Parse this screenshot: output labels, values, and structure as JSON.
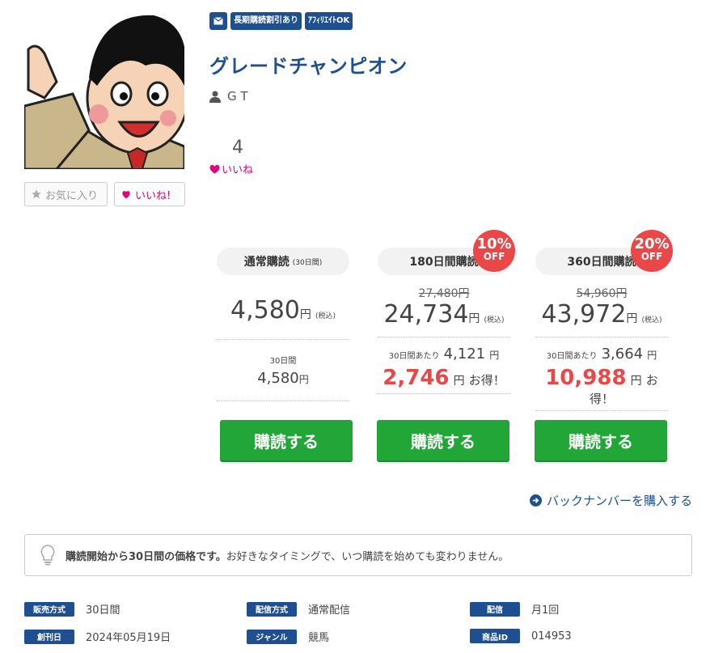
{
  "tags": [
    "長期購読割引あり",
    "ｱﾌｨﾘｴｲﾄOK"
  ],
  "title": "グレードチャンピオン",
  "author": "G T",
  "likes": {
    "count": "4",
    "label": "いいね"
  },
  "actions": {
    "favorite": "お気に入り",
    "like": "いいね!"
  },
  "plans": [
    {
      "name": "通常購読",
      "period_note": "(30日間)",
      "discount": "",
      "old_price": "",
      "price": "4,580",
      "yen": "円",
      "tax": "(税込)",
      "sub_label": "30日間",
      "sub_value": "4,580",
      "save": "",
      "otoku": "",
      "buy": "購読する"
    },
    {
      "name": "180日間購読",
      "period_note": "",
      "discount": "10%",
      "off": "OFF",
      "old_price": "27,480円",
      "price": "24,734",
      "yen": "円",
      "tax": "(税込)",
      "sub_label": "30日間あたり",
      "sub_value": "4,121",
      "save": "2,746",
      "otoku": "お得！",
      "buy": "購読する"
    },
    {
      "name": "360日間購読",
      "period_note": "",
      "discount": "20%",
      "off": "OFF",
      "old_price": "54,960円",
      "price": "43,972",
      "yen": "円",
      "tax": "(税込)",
      "sub_label": "30日間あたり",
      "sub_value": "3,664",
      "save": "10,988",
      "otoku": "お得！",
      "buy": "購読する"
    }
  ],
  "backnumber": "バックナンバーを購入する",
  "note": {
    "bold": "購読開始から30日間の価格です。",
    "text": "お好きなタイミングで、いつ購読を始めても変わりません。"
  },
  "info": [
    {
      "label": "販売方式",
      "value": "30日間"
    },
    {
      "label": "配信方式",
      "value": "通常配信"
    },
    {
      "label": "配信",
      "value": "月1回"
    },
    {
      "label": "創刊日",
      "value": "2024年05月19日"
    },
    {
      "label": "ジャンル",
      "value": "競馬"
    },
    {
      "label": "商品ID",
      "value": "014953"
    }
  ],
  "colors": {
    "brand": "#1d4f91",
    "buy": "#22a638",
    "accent": "#ea4848",
    "like": "#e4007f"
  }
}
